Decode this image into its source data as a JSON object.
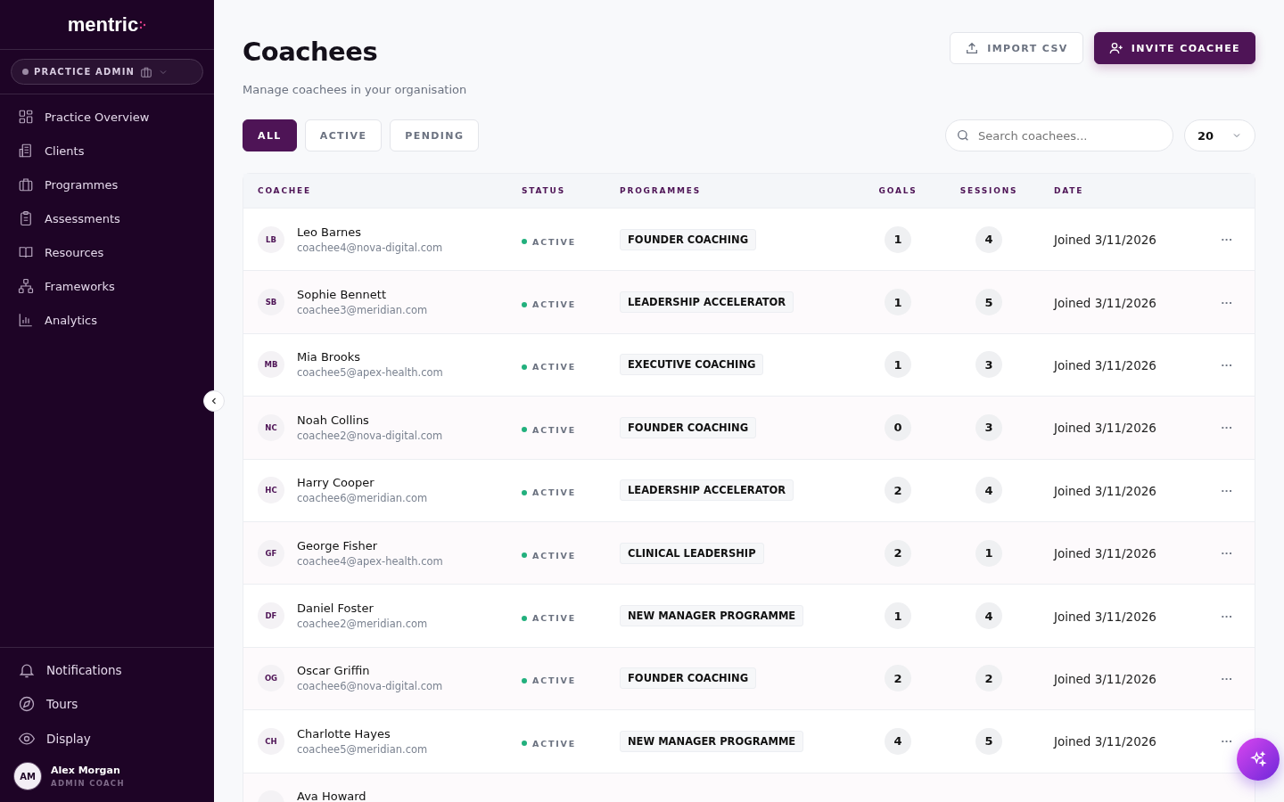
{
  "sidebar": {
    "logo": "mentric",
    "role_switcher": {
      "label": "PRACTICE ADMIN"
    },
    "nav_items": [
      {
        "label": "Practice Overview"
      },
      {
        "label": "Clients"
      },
      {
        "label": "Programmes"
      },
      {
        "label": "Assessments"
      },
      {
        "label": "Resources"
      },
      {
        "label": "Frameworks"
      },
      {
        "label": "Analytics"
      }
    ],
    "footer_items": [
      {
        "label": "Notifications"
      },
      {
        "label": "Tours"
      },
      {
        "label": "Display"
      }
    ],
    "user": {
      "initials": "AM",
      "name": "Alex Morgan",
      "role": "ADMIN COACH"
    }
  },
  "page": {
    "title": "Coachees",
    "subtitle": "Manage coachees in your organisation",
    "actions": [
      {
        "label": "IMPORT CSV",
        "kind": "secondary"
      },
      {
        "label": "INVITE COACHEE",
        "kind": "primary"
      }
    ],
    "filters": [
      {
        "label": "ALL",
        "selected": true
      },
      {
        "label": "ACTIVE",
        "selected": false
      },
      {
        "label": "PENDING",
        "selected": false
      }
    ],
    "search": {
      "placeholder": "Search coachees..."
    },
    "page_size": "20"
  },
  "table": {
    "columns": [
      "COACHEE",
      "STATUS",
      "PROGRAMMES",
      "GOALS",
      "SESSIONS",
      "DATE"
    ],
    "rows": [
      {
        "initials": "LB",
        "name": "Leo Barnes",
        "email": "coachee4@nova-digital.com",
        "status": "ACTIVE",
        "programme": "FOUNDER COACHING",
        "goals": "1",
        "sessions": "4",
        "date": "Joined 3/11/2026",
        "menu": "···"
      },
      {
        "initials": "SB",
        "name": "Sophie Bennett",
        "email": "coachee3@meridian.com",
        "status": "ACTIVE",
        "programme": "LEADERSHIP ACCELERATOR",
        "goals": "1",
        "sessions": "5",
        "date": "Joined 3/11/2026",
        "menu": "···"
      },
      {
        "initials": "MB",
        "name": "Mia Brooks",
        "email": "coachee5@apex-health.com",
        "status": "ACTIVE",
        "programme": "EXECUTIVE COACHING",
        "goals": "1",
        "sessions": "3",
        "date": "Joined 3/11/2026",
        "menu": "···"
      },
      {
        "initials": "NC",
        "name": "Noah Collins",
        "email": "coachee2@nova-digital.com",
        "status": "ACTIVE",
        "programme": "FOUNDER COACHING",
        "goals": "0",
        "sessions": "3",
        "date": "Joined 3/11/2026",
        "menu": "···"
      },
      {
        "initials": "HC",
        "name": "Harry Cooper",
        "email": "coachee6@meridian.com",
        "status": "ACTIVE",
        "programme": "LEADERSHIP ACCELERATOR",
        "goals": "2",
        "sessions": "4",
        "date": "Joined 3/11/2026",
        "menu": "···"
      },
      {
        "initials": "GF",
        "name": "George Fisher",
        "email": "coachee4@apex-health.com",
        "status": "ACTIVE",
        "programme": "CLINICAL LEADERSHIP",
        "goals": "2",
        "sessions": "1",
        "date": "Joined 3/11/2026",
        "menu": "···"
      },
      {
        "initials": "DF",
        "name": "Daniel Foster",
        "email": "coachee2@meridian.com",
        "status": "ACTIVE",
        "programme": "NEW MANAGER PROGRAMME",
        "goals": "1",
        "sessions": "4",
        "date": "Joined 3/11/2026",
        "menu": "···"
      },
      {
        "initials": "OG",
        "name": "Oscar Griffin",
        "email": "coachee6@nova-digital.com",
        "status": "ACTIVE",
        "programme": "FOUNDER COACHING",
        "goals": "2",
        "sessions": "2",
        "date": "Joined 3/11/2026",
        "menu": "···"
      },
      {
        "initials": "CH",
        "name": "Charlotte Hayes",
        "email": "coachee5@meridian.com",
        "status": "ACTIVE",
        "programme": "NEW MANAGER PROGRAMME",
        "goals": "4",
        "sessions": "5",
        "date": "Joined 3/11/2026",
        "menu": "···"
      },
      {
        "name": "Ava Howard"
      }
    ]
  }
}
